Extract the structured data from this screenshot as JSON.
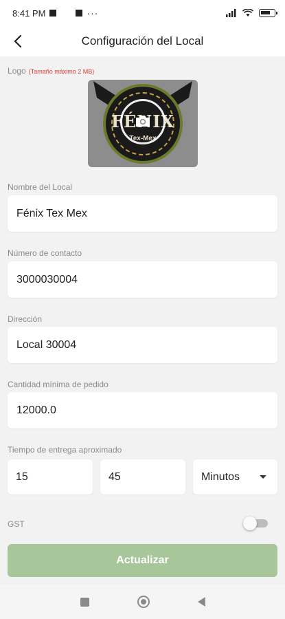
{
  "status_bar": {
    "time": "8:41 PM",
    "overflow": "···",
    "icons": [
      "notification-icon",
      "notification-icon",
      "signal-icon",
      "wifi-icon",
      "battery-icon"
    ]
  },
  "app_bar": {
    "title": "Configuración del Local",
    "back_icon": "back-arrow-icon"
  },
  "logo": {
    "label": "Logo",
    "hint": "(Tamaño máximo 2 MB)",
    "brand_text": "FÉNIX",
    "brand_subtext": "Tex-Mex",
    "camera_icon": "camera-icon"
  },
  "fields": {
    "name": {
      "label": "Nombre del Local",
      "value": "Fénix Tex Mex"
    },
    "contact": {
      "label": "Número de contacto",
      "value": "3000030004"
    },
    "address": {
      "label": "Dirección",
      "value": "Local 30004"
    },
    "min_order": {
      "label": "Cantidad mínima de pedido",
      "value": "12000.0"
    },
    "delivery": {
      "label": "Tiempo de entrega aproximado",
      "from": "15",
      "to": "45",
      "unit": "Minutos"
    }
  },
  "gst": {
    "label": "GST",
    "enabled": false
  },
  "update_button": {
    "label": "Actualizar",
    "color": "#a7c79b"
  },
  "nav_bar": {
    "icons": [
      "recent-apps-icon",
      "home-icon",
      "back-icon"
    ]
  },
  "colors": {
    "accent": "#a7c79b",
    "hint_red": "#e53935",
    "background": "#f2f2f2"
  }
}
